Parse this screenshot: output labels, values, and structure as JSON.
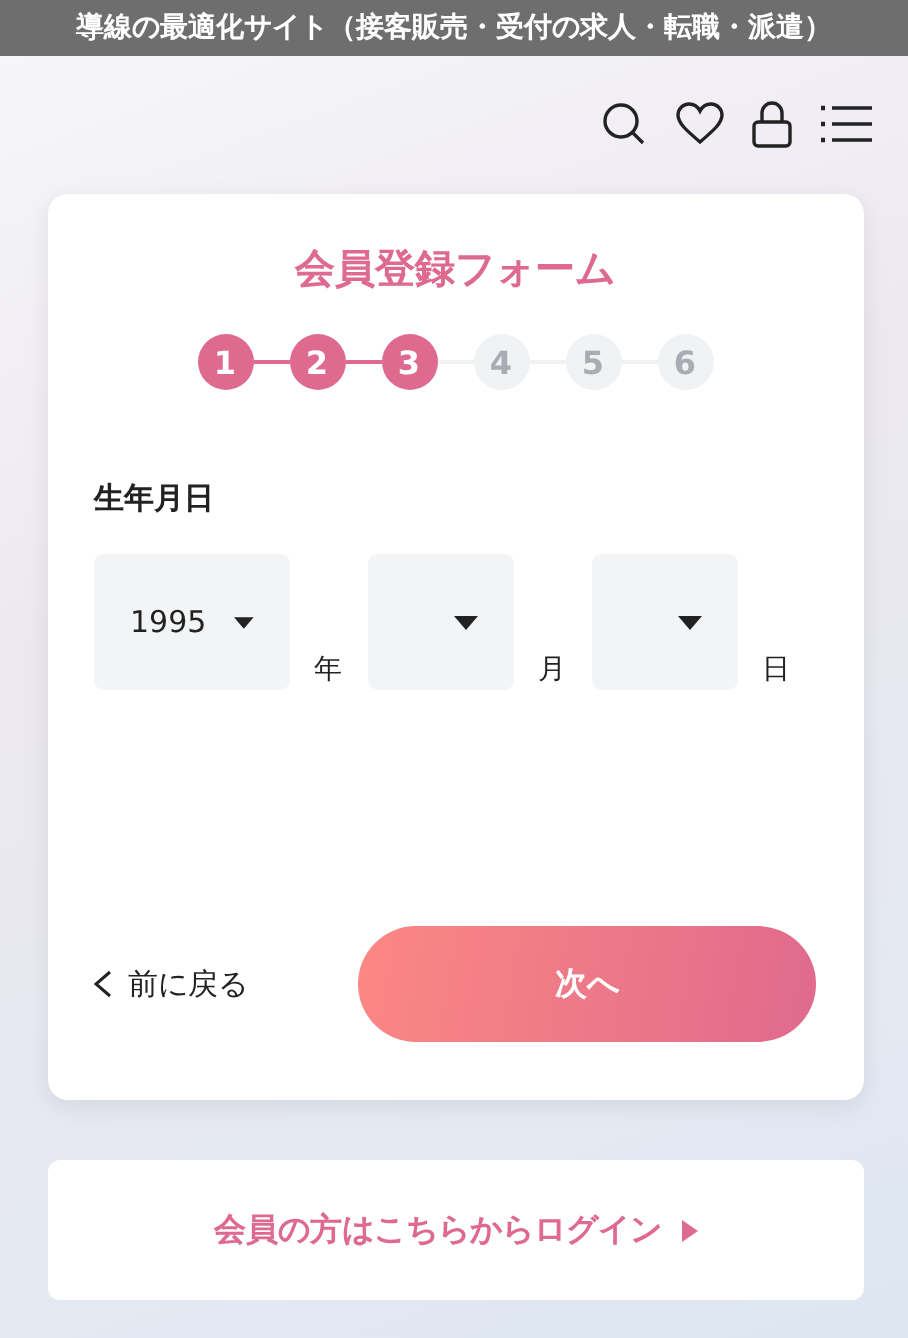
{
  "top_bar": {
    "text": "導線の最適化サイト（接客販売・受付の求人・転職・派遣）"
  },
  "form": {
    "title": "会員登録フォーム",
    "steps": [
      {
        "label": "1",
        "done": true
      },
      {
        "label": "2",
        "done": true
      },
      {
        "label": "3",
        "done": true
      },
      {
        "label": "4",
        "done": false
      },
      {
        "label": "5",
        "done": false
      },
      {
        "label": "6",
        "done": false
      }
    ],
    "field_label": "生年月日",
    "selects": [
      {
        "value": "1995",
        "unit": "年"
      },
      {
        "unit": "月"
      },
      {
        "unit": "日"
      }
    ],
    "back": "前に戻る",
    "next": "次へ"
  },
  "login": {
    "text": "会員の方はこちらからログイン"
  }
}
